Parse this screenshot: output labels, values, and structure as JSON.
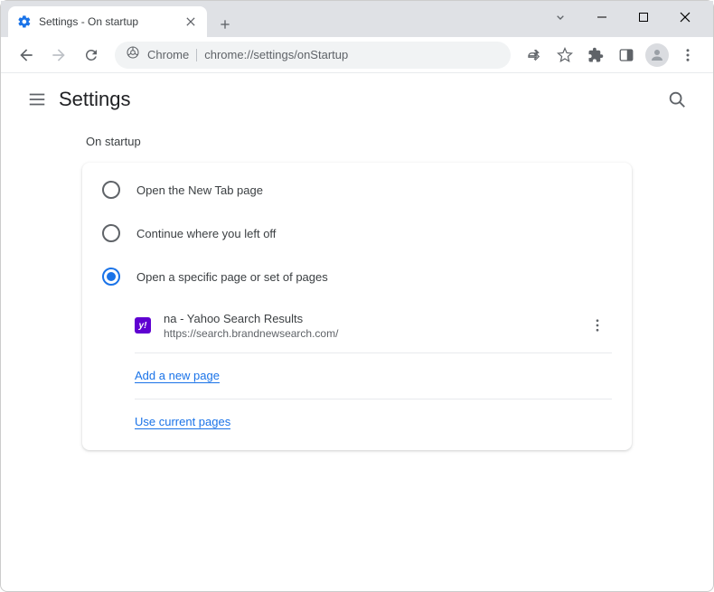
{
  "window": {
    "tab_title": "Settings - On startup"
  },
  "omnibox": {
    "prefix": "Chrome",
    "url": "chrome://settings/onStartup"
  },
  "header": {
    "title": "Settings"
  },
  "section": {
    "label": "On startup",
    "options": [
      {
        "label": "Open the New Tab page",
        "selected": false
      },
      {
        "label": "Continue where you left off",
        "selected": false
      },
      {
        "label": "Open a specific page or set of pages",
        "selected": true
      }
    ],
    "pages": [
      {
        "title": "na - Yahoo Search Results",
        "url": "https://search.brandnewsearch.com/"
      }
    ],
    "links": {
      "add": "Add a new page",
      "use_current": "Use current pages"
    }
  }
}
